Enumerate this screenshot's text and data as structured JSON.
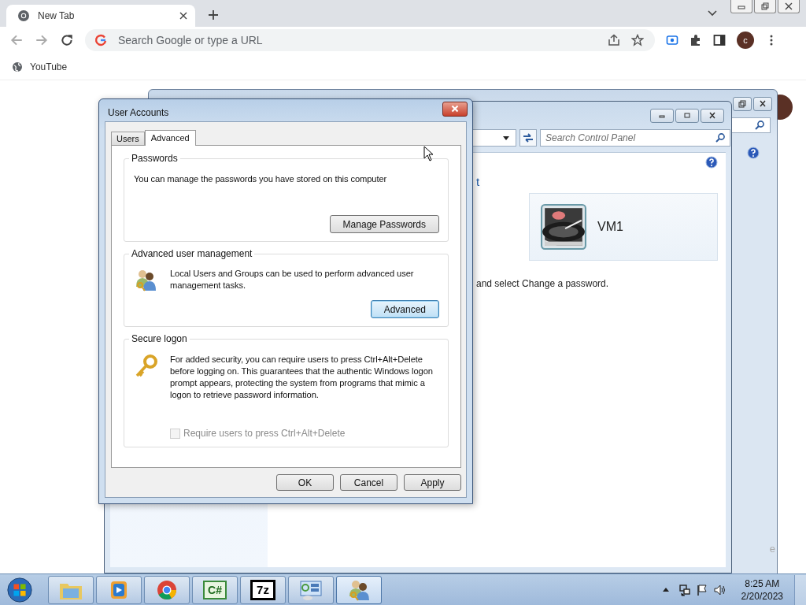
{
  "browser": {
    "tab": {
      "title": "New Tab",
      "selected": true
    },
    "address": {
      "placeholder": "Search Google or type a URL"
    },
    "profile": {
      "initial": "c"
    },
    "bookmarks": [
      {
        "label": "YouTube"
      }
    ]
  },
  "desktop": {
    "back_window": {
      "fragment": "e"
    },
    "control_panel": {
      "search": {
        "placeholder": "Search Control Panel"
      },
      "link_fragment": "t",
      "account": {
        "name": "VM1"
      },
      "instruction": "and select Change a password."
    },
    "dialog": {
      "title": "User Accounts",
      "tabs": [
        {
          "label": "Users",
          "selected": false
        },
        {
          "label": "Advanced",
          "selected": true
        }
      ],
      "groups": [
        {
          "kind": "passwords",
          "title": "Passwords",
          "text": "You can manage the passwords you have stored on this computer",
          "button": {
            "label": "Manage Passwords",
            "focused": false
          }
        },
        {
          "kind": "users",
          "title": "Advanced user management",
          "text": "Local Users and Groups can be used to perform advanced user management tasks.",
          "button": {
            "label": "Advanced",
            "focused": true
          }
        },
        {
          "kind": "key",
          "title": "Secure logon",
          "text": "For added security, you can require users to press Ctrl+Alt+Delete before logging on. This guarantees that the authentic Windows logon prompt appears, protecting the system from programs that mimic a logon to retrieve password information.",
          "checkbox": {
            "label": "Require users to press Ctrl+Alt+Delete",
            "checked": false,
            "disabled": true
          }
        }
      ],
      "buttons": [
        {
          "label": "OK"
        },
        {
          "label": "Cancel"
        },
        {
          "label": "Apply"
        }
      ]
    }
  },
  "taskbar": {
    "apps": [
      {
        "kind": "explorer",
        "selected": false
      },
      {
        "kind": "media",
        "selected": false
      },
      {
        "kind": "chrome",
        "selected": false
      },
      {
        "kind": "csharp",
        "glyph": "C#",
        "selected": false
      },
      {
        "kind": "sevenzip",
        "glyph": "7z",
        "selected": false
      },
      {
        "kind": "control",
        "selected": false
      },
      {
        "kind": "users",
        "selected": true
      }
    ],
    "clock": {
      "time": "8:25 AM",
      "date": "2/20/2023"
    }
  }
}
